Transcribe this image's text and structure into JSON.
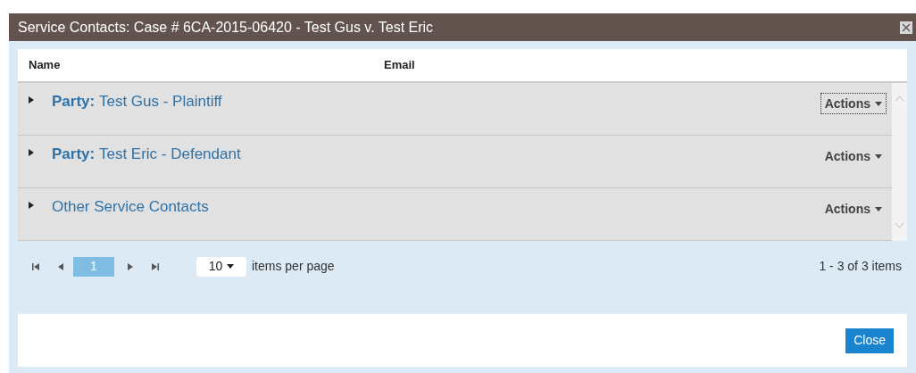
{
  "window": {
    "title": "Service Contacts: Case # 6CA-2015-06420 - Test Gus v. Test Eric"
  },
  "table": {
    "columns": [
      "Name",
      "Email"
    ],
    "groups": [
      {
        "prefix": "Party:",
        "label": "Test Gus - Plaintiff",
        "expanded": false,
        "actions": "Actions",
        "focused": true
      },
      {
        "prefix": "Party:",
        "label": "Test Eric - Defendant",
        "expanded": false,
        "actions": "Actions",
        "focused": false
      },
      {
        "label": "Other Service Contacts",
        "expanded": false,
        "actions": "Actions",
        "focused": false
      }
    ]
  },
  "pager": {
    "pages": [
      {
        "label": "1",
        "selected": true
      }
    ],
    "page_size": "10",
    "page_size_label": "items per page",
    "summary": "1 - 3 of 3 items"
  },
  "footer": {
    "button": "Close"
  }
}
